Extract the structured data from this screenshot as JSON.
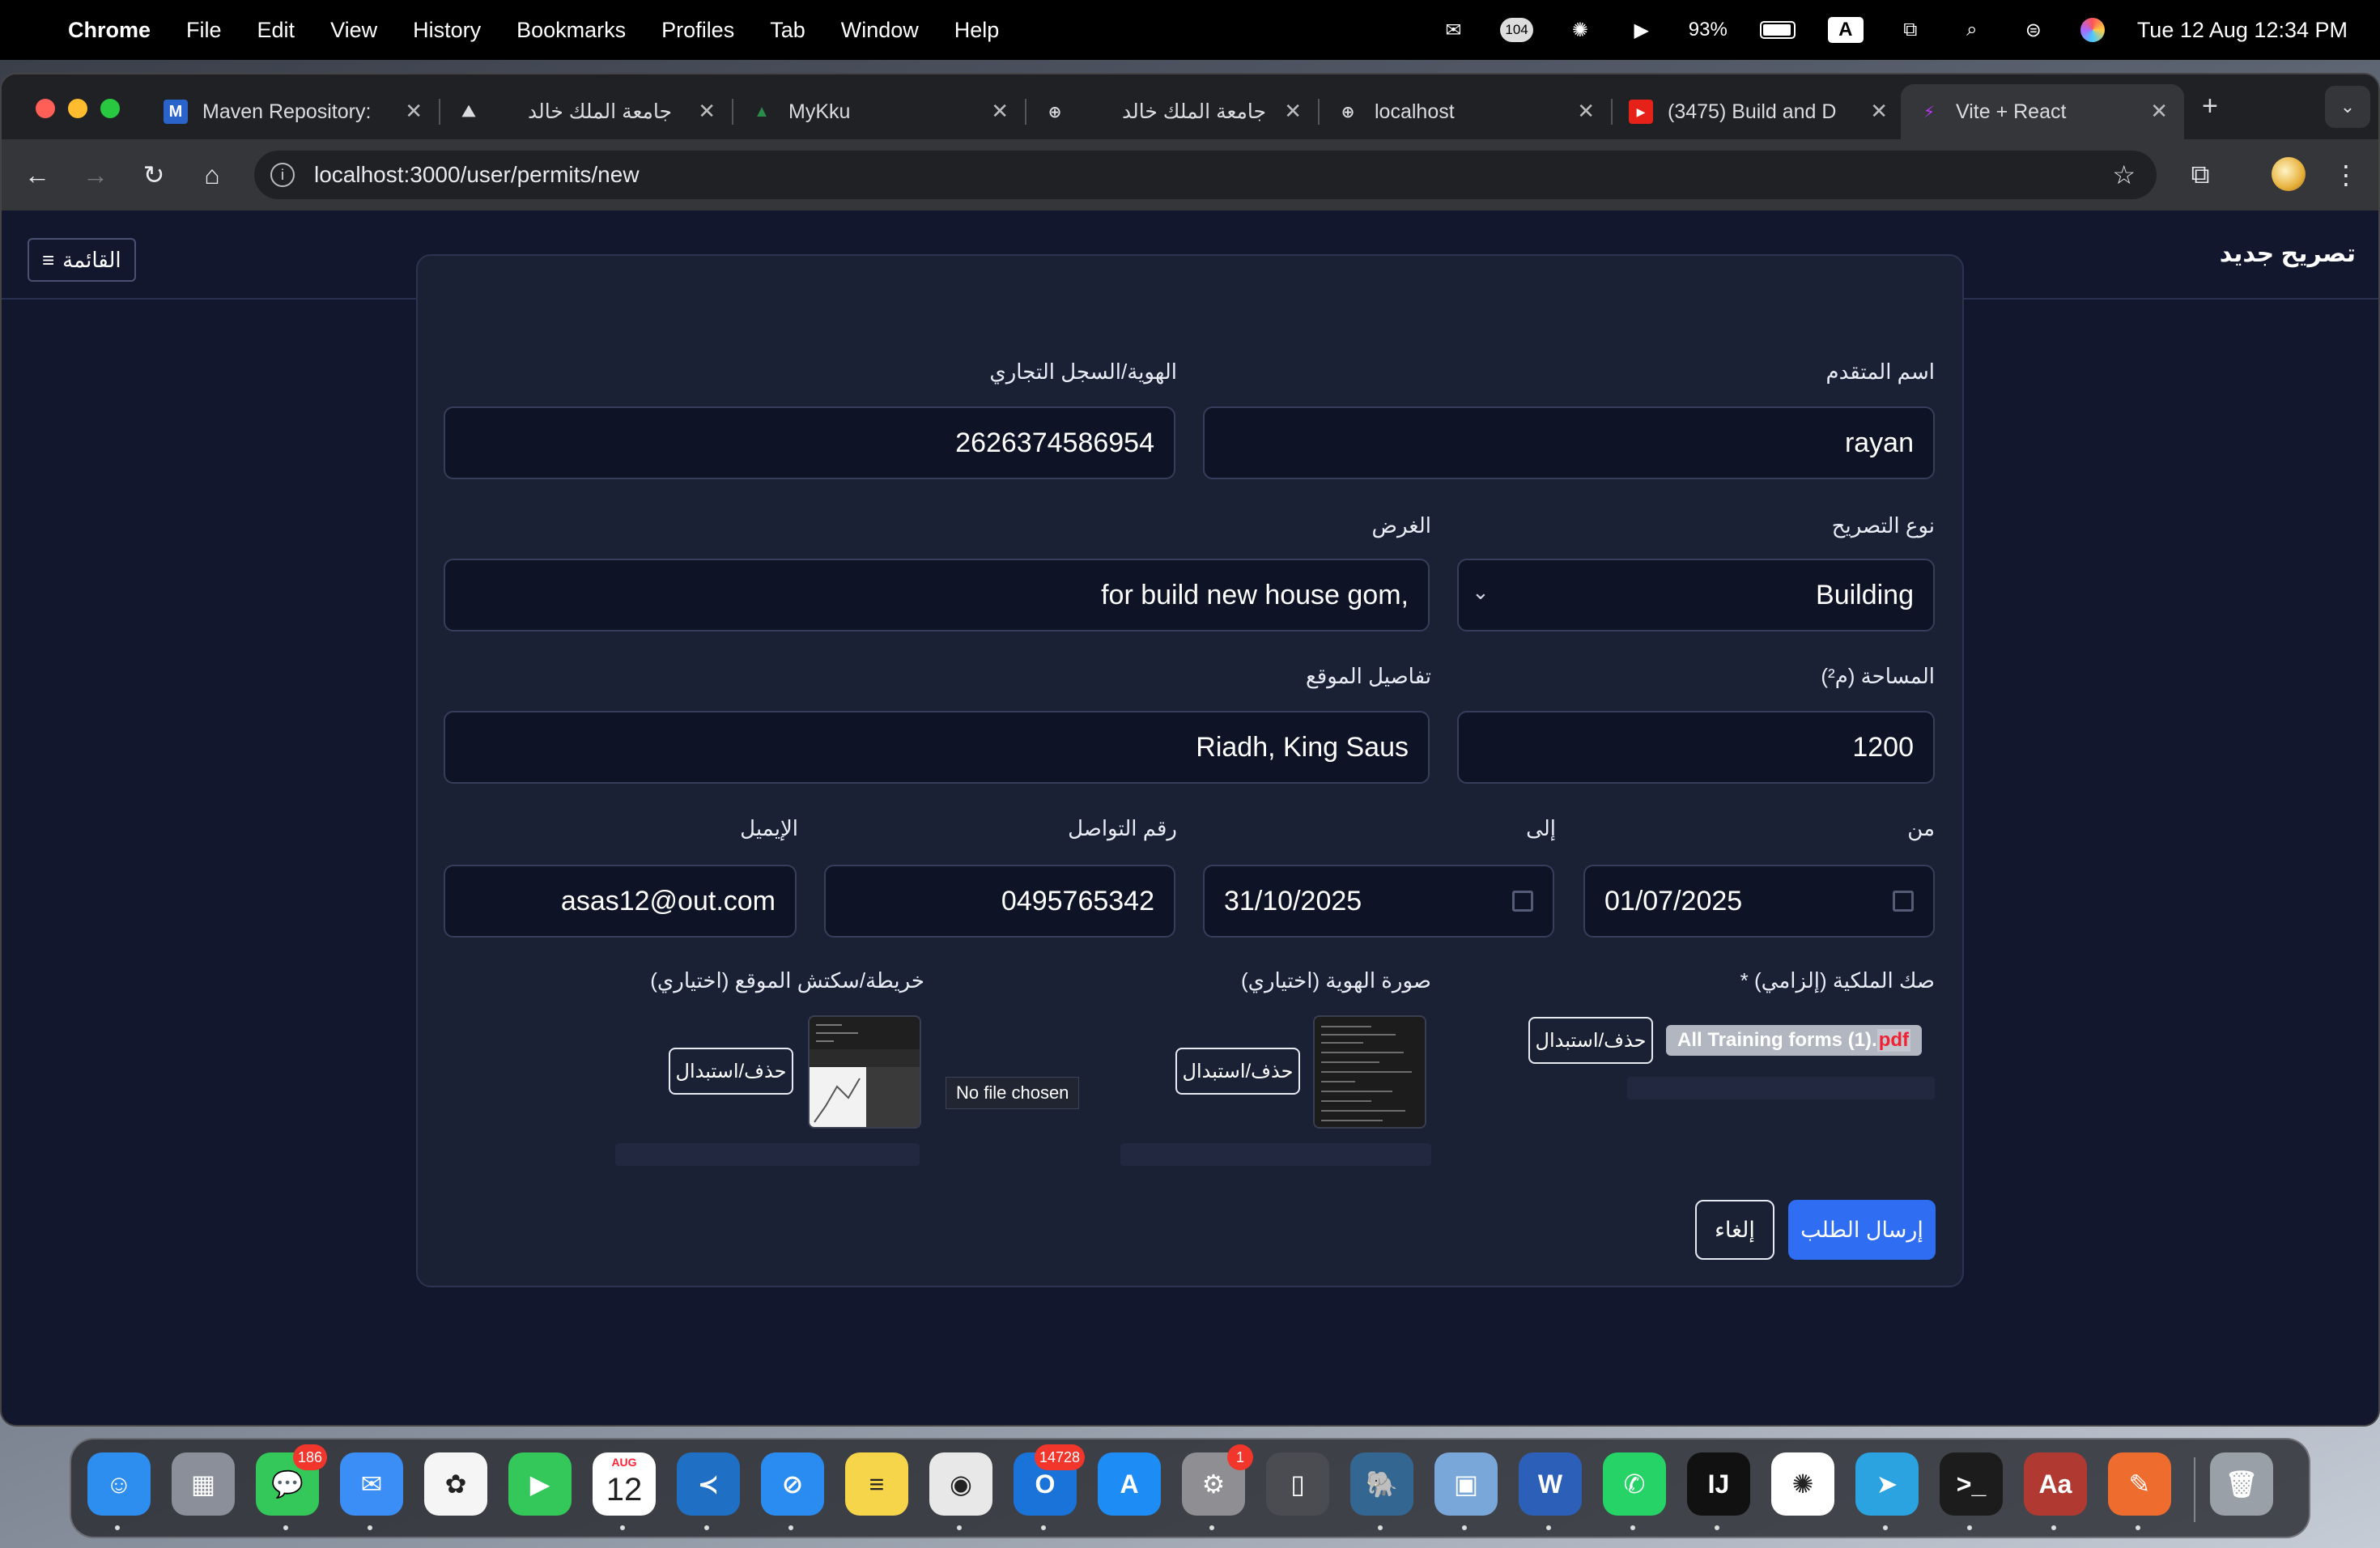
{
  "menubar": {
    "app_name": "Chrome",
    "menus": [
      "File",
      "Edit",
      "View",
      "History",
      "Bookmarks",
      "Profiles",
      "Tab",
      "Window",
      "Help"
    ],
    "status_badge": "104",
    "battery": "93%",
    "input_method": "A",
    "datetime": "Tue 12 Aug  12:34 PM"
  },
  "tabs": [
    {
      "title": "Maven Repository:",
      "favicon": "M",
      "favicon_color": "#2a63c9"
    },
    {
      "title": "جامعة الملك خالد",
      "favicon": "⛰",
      "favicon_color": "transparent"
    },
    {
      "title": "MyKku",
      "favicon": "▲",
      "favicon_color": "transparent"
    },
    {
      "title": "جامعة الملك خالد",
      "favicon": "⊕",
      "favicon_color": "transparent"
    },
    {
      "title": "localhost",
      "favicon": "⊕",
      "favicon_color": "transparent"
    },
    {
      "title": "(3475) Build and D",
      "favicon": "▶",
      "favicon_color": "#e62117"
    },
    {
      "title": "Vite + React",
      "favicon": "⚡",
      "favicon_color": "transparent"
    }
  ],
  "address": {
    "url": "localhost:3000/user/permits/new"
  },
  "header": {
    "title": "تصريح جديد",
    "menu_label": "القائمة"
  },
  "form": {
    "applicant_name": {
      "label": "اسم المتقدم",
      "value": "rayan"
    },
    "id_record": {
      "label": "الهوية/السجل التجاري",
      "value": "2626374586954"
    },
    "permit_type": {
      "label": "نوع التصريح",
      "value": "Building"
    },
    "purpose": {
      "label": "الغرض",
      "value": "for build new house gom,"
    },
    "area": {
      "label": "المساحة (م²)",
      "value": "1200"
    },
    "location": {
      "label": "تفاصيل الموقع",
      "value": "Riadh, King Saus"
    },
    "from": {
      "label": "من",
      "value": "01/07/2025"
    },
    "to": {
      "label": "إلى",
      "value": "31/10/2025"
    },
    "phone": {
      "label": "رقم التواصل",
      "value": "0495765342"
    },
    "email": {
      "label": "الإيميل",
      "value": "asas12@out.com"
    },
    "deed": {
      "label": "صك الملكية (إلزامي) *",
      "file_name": "All Training forms (1).",
      "file_ext": "pdf",
      "replace_label": "حذف/استبدال"
    },
    "id_photo": {
      "label": "صورة الهوية (اختياري)",
      "replace_label": "حذف/استبدال"
    },
    "site_map": {
      "label": "خريطة/سكتش الموقع (اختياري)",
      "no_file": "No file chosen",
      "replace_label": "حذف/استبدال"
    },
    "submit_label": "إرسال الطلب",
    "cancel_label": "إلغاء"
  },
  "dock": {
    "apps": [
      {
        "name": "Finder",
        "color": "#2e8ef0",
        "glyph": "☺"
      },
      {
        "name": "Launchpad",
        "color": "#8a8f99",
        "glyph": "▦"
      },
      {
        "name": "Messages",
        "color": "#34c759",
        "glyph": "💬",
        "badge": "186"
      },
      {
        "name": "Mail",
        "color": "#3a8ef5",
        "glyph": "✉"
      },
      {
        "name": "Photos",
        "color": "#f5f5f5",
        "glyph": "✿"
      },
      {
        "name": "FaceTime",
        "color": "#34c759",
        "glyph": "▶"
      },
      {
        "name": "Calendar",
        "color": "#ffffff",
        "glyph": "12",
        "sub": "AUG"
      },
      {
        "name": "VS Code",
        "color": "#1f6fc5",
        "glyph": "≺"
      },
      {
        "name": "Safari",
        "color": "#2a8cf0",
        "glyph": "⊘"
      },
      {
        "name": "Notes",
        "color": "#f7d54a",
        "glyph": "≡"
      },
      {
        "name": "Chrome",
        "color": "#e8e8e8",
        "glyph": "◉"
      },
      {
        "name": "Outlook",
        "color": "#1a73d9",
        "glyph": "O",
        "badge": "14728"
      },
      {
        "name": "App Store",
        "color": "#1d8cf5",
        "glyph": "A"
      },
      {
        "name": "System Settings",
        "color": "#8e8e93",
        "glyph": "⚙",
        "badge": "1"
      },
      {
        "name": "iPhone Mirroring",
        "color": "#4b4b52",
        "glyph": "▯"
      },
      {
        "name": "pgAdmin",
        "color": "#336791",
        "glyph": "🐘"
      },
      {
        "name": "Preview",
        "color": "#7aa7d9",
        "glyph": "▣"
      },
      {
        "name": "Word",
        "color": "#2b5fb8",
        "glyph": "W"
      },
      {
        "name": "WhatsApp",
        "color": "#25d366",
        "glyph": "✆"
      },
      {
        "name": "IntelliJ IDEA",
        "color": "#111111",
        "glyph": "IJ"
      },
      {
        "name": "ChatGPT",
        "color": "#ffffff",
        "glyph": "✺"
      },
      {
        "name": "Telegram",
        "color": "#2aa3e0",
        "glyph": "➤"
      },
      {
        "name": "Terminal",
        "color": "#1c1c1c",
        "glyph": ">_"
      },
      {
        "name": "Dictionary",
        "color": "#b03a32",
        "glyph": "Aa"
      },
      {
        "name": "Postman",
        "color": "#ef6c2f",
        "glyph": "✎"
      },
      {
        "name": "Trash",
        "color": "#9aa0a8",
        "glyph": "🗑"
      }
    ]
  },
  "colors": {
    "accent": "#2f6df2",
    "page_bg": "#12172e",
    "card_bg": "#1b2135"
  }
}
